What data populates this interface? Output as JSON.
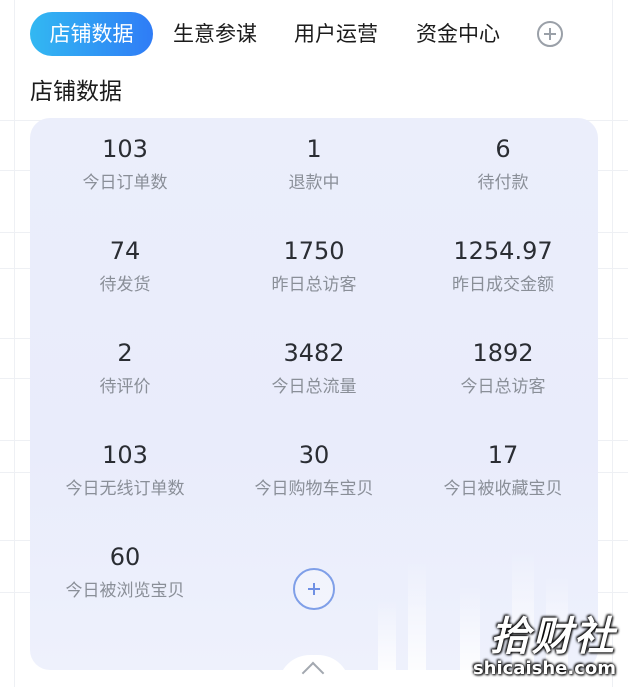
{
  "tabs": [
    {
      "label": "店铺数据",
      "active": true
    },
    {
      "label": "生意参谋",
      "active": false
    },
    {
      "label": "用户运营",
      "active": false
    },
    {
      "label": "资金中心",
      "active": false
    }
  ],
  "add_tab_icon": "plus-circle-icon",
  "section": {
    "title": "店铺数据"
  },
  "metrics": [
    {
      "value": "103",
      "label": "今日订单数"
    },
    {
      "value": "1",
      "label": "退款中"
    },
    {
      "value": "6",
      "label": "待付款"
    },
    {
      "value": "74",
      "label": "待发货"
    },
    {
      "value": "1750",
      "label": "昨日总访客"
    },
    {
      "value": "1254.97",
      "label": "昨日成交金额"
    },
    {
      "value": "2",
      "label": "待评价"
    },
    {
      "value": "3482",
      "label": "今日总流量"
    },
    {
      "value": "1892",
      "label": "今日总访客"
    },
    {
      "value": "103",
      "label": "今日无线订单数"
    },
    {
      "value": "30",
      "label": "今日购物车宝贝"
    },
    {
      "value": "17",
      "label": "今日被收藏宝贝"
    },
    {
      "value": "60",
      "label": "今日被浏览宝贝"
    }
  ],
  "add_metric_icon": "plus-circle-icon",
  "collapse_icon": "chevron-up-icon",
  "watermark": {
    "cn": "拾财社",
    "en": "shicaishe.com"
  },
  "colors": {
    "accent_start": "#32b8f2",
    "accent_end": "#2f7cf6",
    "card_bg": "#ebeefb",
    "label_gray": "#8a8f98"
  }
}
